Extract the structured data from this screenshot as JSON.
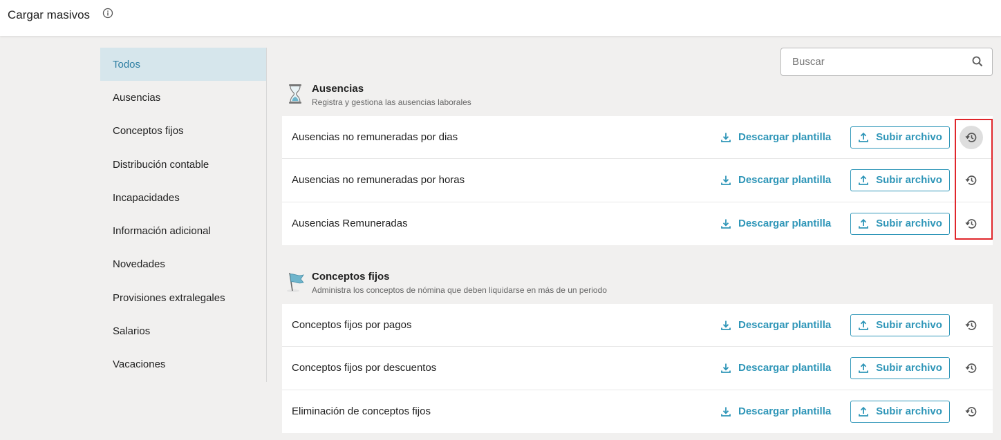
{
  "header": {
    "title": "Cargar masivos",
    "info_icon": "info-circle-icon"
  },
  "sidebar": {
    "items": [
      {
        "label": "Todos",
        "active": true
      },
      {
        "label": "Ausencias"
      },
      {
        "label": "Conceptos fijos"
      },
      {
        "label": "Distribución contable"
      },
      {
        "label": "Incapacidades"
      },
      {
        "label": "Información adicional"
      },
      {
        "label": "Novedades"
      },
      {
        "label": "Provisiones extralegales"
      },
      {
        "label": "Salarios"
      },
      {
        "label": "Vacaciones"
      }
    ]
  },
  "search": {
    "placeholder": "Buscar",
    "value": "",
    "icon": "search-icon"
  },
  "sections": [
    {
      "title": "Ausencias",
      "description": "Registra y gestiona las ausencias laborales",
      "icon": "hourglass-icon",
      "rows": [
        {
          "label": "Ausencias no remuneradas por dias"
        },
        {
          "label": "Ausencias no remuneradas por horas"
        },
        {
          "label": "Ausencias Remuneradas"
        }
      ]
    },
    {
      "title": "Conceptos fijos",
      "description": "Administra los conceptos de nómina que deben liquidarse en más de un periodo",
      "icon": "flag-icon",
      "rows": [
        {
          "label": "Conceptos fijos por pagos"
        },
        {
          "label": "Conceptos fijos por descuentos"
        },
        {
          "label": "Eliminación de conceptos fijos"
        }
      ]
    }
  ],
  "actions": {
    "download_label": "Descargar plantilla",
    "upload_label": "Subir archivo",
    "history_icon": "history-icon"
  },
  "colors": {
    "accent": "#2f96b8",
    "active_bg": "#d6e6ec",
    "highlight": "#e0262b"
  }
}
